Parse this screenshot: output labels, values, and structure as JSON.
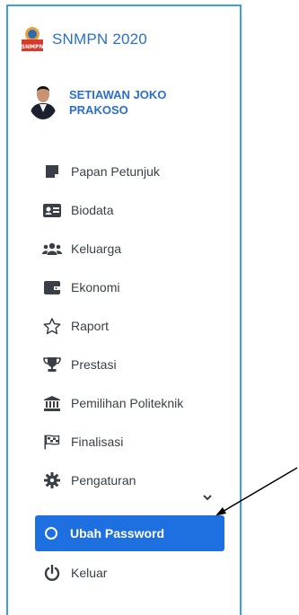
{
  "brand": {
    "title": "SNMPN 2020",
    "logo_text": "SNMPN"
  },
  "user": {
    "name": "SETIAWAN JOKO PRAKOSO"
  },
  "menu": {
    "items": [
      {
        "label": "Papan Petunjuk",
        "icon": "note-icon"
      },
      {
        "label": "Biodata",
        "icon": "id-card-icon"
      },
      {
        "label": "Keluarga",
        "icon": "users-icon"
      },
      {
        "label": "Ekonomi",
        "icon": "wallet-icon"
      },
      {
        "label": "Raport",
        "icon": "star-icon"
      },
      {
        "label": "Prestasi",
        "icon": "trophy-icon"
      },
      {
        "label": "Pemilihan Politeknik",
        "icon": "institution-icon"
      },
      {
        "label": "Finalisasi",
        "icon": "checkered-flag-icon"
      },
      {
        "label": "Pengaturan",
        "icon": "gear-icon"
      }
    ],
    "submenu_active": {
      "label": "Ubah Password",
      "icon": "circle-icon"
    },
    "logout": {
      "label": "Keluar",
      "icon": "power-icon"
    }
  },
  "colors": {
    "accent": "#1e6fe0",
    "brand_text": "#2b6fc9",
    "border": "#3ba0dc",
    "text": "#3a3f47"
  }
}
